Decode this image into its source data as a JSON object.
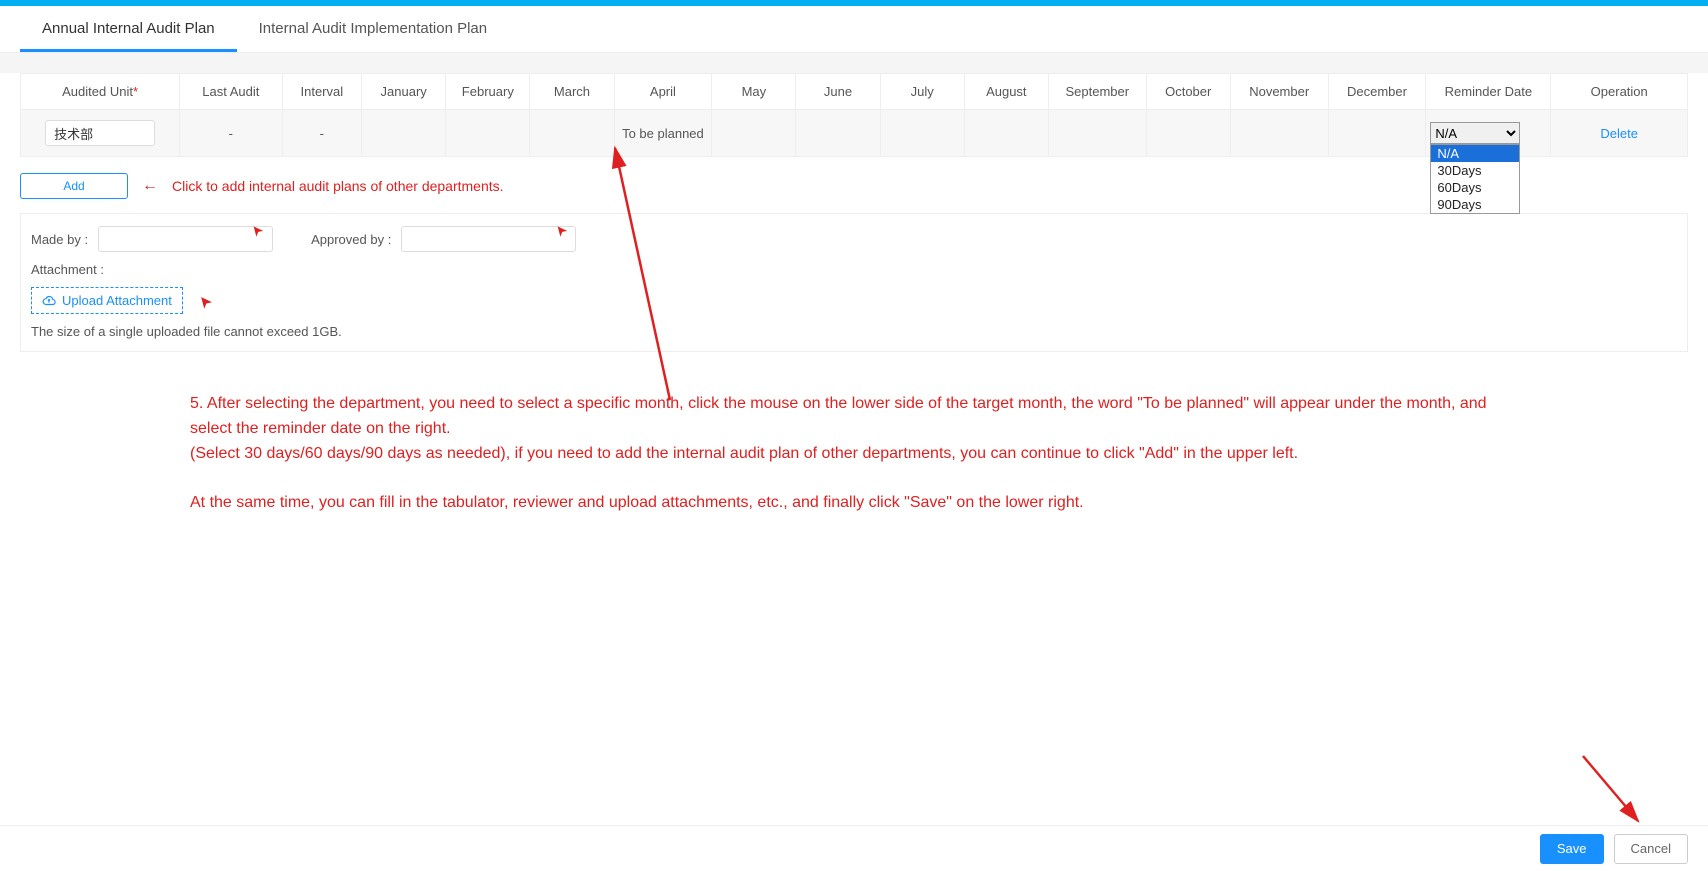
{
  "tabs": {
    "annual": "Annual Internal Audit Plan",
    "implementation": "Internal Audit Implementation Plan"
  },
  "table": {
    "headers": {
      "audited_unit": "Audited Unit",
      "last_audit": "Last Audit",
      "interval": "Interval",
      "m1": "January",
      "m2": "February",
      "m3": "March",
      "m4": "April",
      "m5": "May",
      "m6": "June",
      "m7": "July",
      "m8": "August",
      "m9": "September",
      "m10": "October",
      "m11": "November",
      "m12": "December",
      "reminder": "Reminder Date",
      "operation": "Operation"
    },
    "row": {
      "unit_value": "技术部",
      "last_audit": "-",
      "interval": "-",
      "april_status": "To be planned",
      "reminder_selected": "N/A",
      "reminder_options": {
        "na": "N/A",
        "d30": "30Days",
        "d60": "60Days",
        "d90": "90Days"
      },
      "delete_label": "Delete"
    }
  },
  "add": {
    "label": "Add",
    "hint": "Click to add internal audit plans of other departments."
  },
  "form": {
    "made_by_label": "Made by :",
    "approved_by_label": "Approved by :",
    "attachment_label": "Attachment :",
    "upload_label": "Upload Attachment",
    "size_hint": "The size of a single uploaded file cannot exceed 1GB."
  },
  "instructions": {
    "p1": "5. After selecting the department, you need to select a specific month, click the mouse on the lower side of the target month, the word \"To be planned\" will appear under the month, and select the reminder date on the right.",
    "p2": "(Select 30 days/60 days/90 days as needed), if you need to add the internal audit plan of other departments, you can continue to click \"Add\" in the upper left.",
    "p3": "At the same time, you can fill in the tabulator, reviewer and upload attachments, etc., and finally click \"Save\" on the lower right."
  },
  "footer": {
    "save": "Save",
    "cancel": "Cancel"
  }
}
